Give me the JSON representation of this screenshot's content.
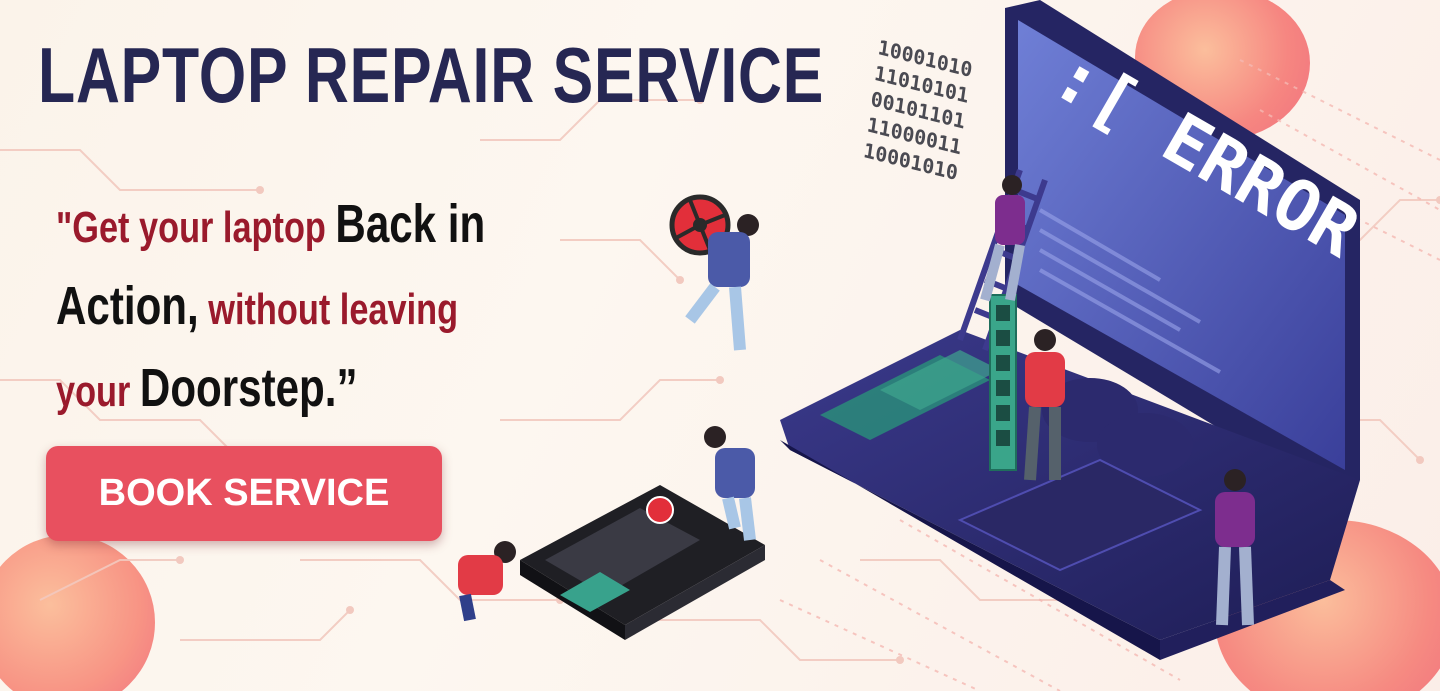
{
  "banner": {
    "title": "LAPTOP REPAIR SERVICE",
    "quote": {
      "part1": "\"Get your laptop ",
      "part2": "Back in",
      "part3": "Action,",
      "part4": " without leaving",
      "part5": "your ",
      "part6": "Doorstep.”"
    },
    "cta_label": "BOOK SERVICE",
    "binary_lines": [
      "10001010",
      "11010101",
      "00101101",
      "11000011",
      "10001010"
    ],
    "screen_text": ":[ ERROR"
  },
  "colors": {
    "title": "#262753",
    "quote_red": "#9a1a2c",
    "quote_black": "#111111",
    "button": "#e8505f",
    "accent_blob": "#ee5a6c"
  },
  "icons": [
    "fan-icon",
    "laptop-illustration",
    "technician-illustration",
    "motherboard-illustration",
    "ladder-icon",
    "ram-module-icon"
  ]
}
